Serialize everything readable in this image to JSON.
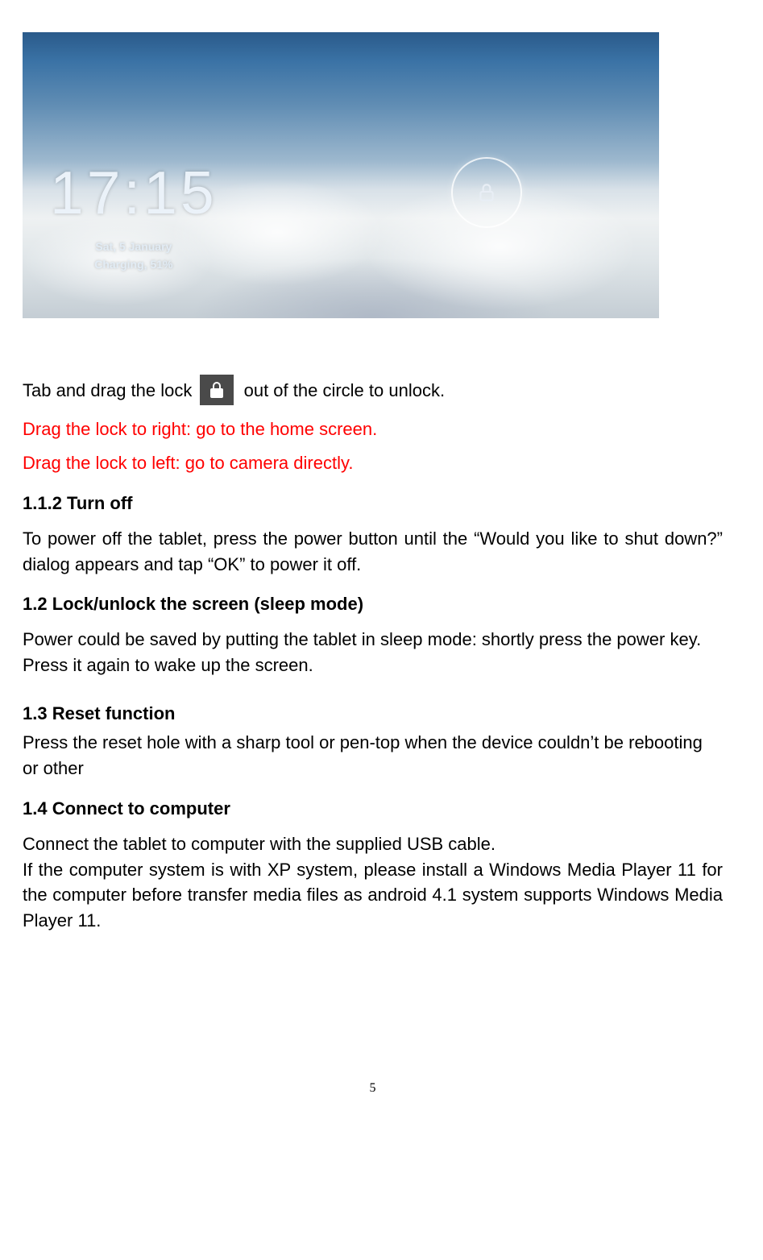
{
  "lockscreen": {
    "time": "17:15",
    "date": "Sat, 5 January",
    "charging": "Charging, 51%"
  },
  "para1_a": "Tab and drag the lock ",
  "para1_b": " out of the circle to unlock.",
  "para_right": "Drag the lock to right: go to the home screen.",
  "para_left": "Drag the lock to left: go to camera directly.",
  "h_112": "1.1.2 Turn off",
  "body_112": "To power off the tablet, press the power button until the “Would you like to shut down?” dialog appears and tap “OK” to power it off.",
  "h_12": "1.2 Lock/unlock the screen (sleep mode)",
  "body_12": "Power could be saved by putting the tablet in sleep mode: shortly press the power key. Press it again to wake up the screen.",
  "h_13": "1.3 Reset function",
  "body_13": "Press the reset hole with a sharp tool or pen-top when the device couldn’t be rebooting or other",
  "h_14": "1.4 Connect to computer",
  "body_14a": "Connect the tablet to computer with the supplied USB cable.",
  "body_14b": "If the computer system is with XP system, please install a Windows Media Player 11 for the computer before transfer media files as android 4.1 system supports Windows Media Player 11.",
  "page_number": "5"
}
